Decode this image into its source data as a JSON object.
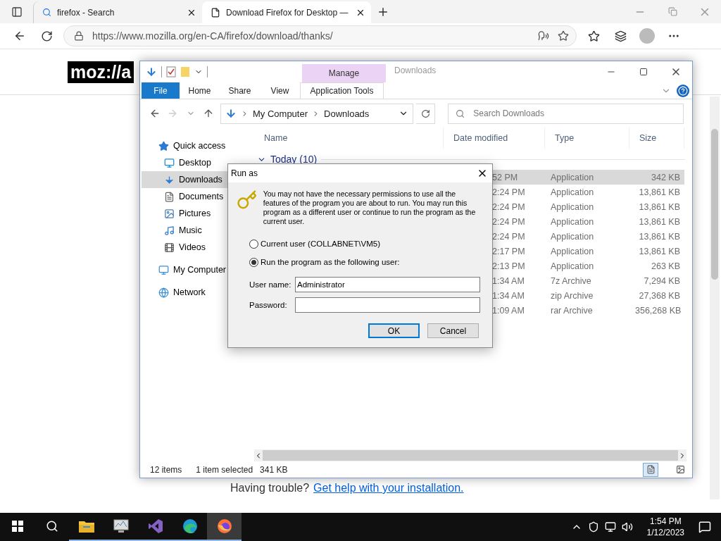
{
  "browser": {
    "tabs": [
      {
        "title": "firefox - Search",
        "kind": "search",
        "selected": false
      },
      {
        "title": "Download Firefox for Desktop —",
        "kind": "page",
        "selected": true
      }
    ],
    "url": "https://www.mozilla.org/en-CA/firefox/download/thanks/",
    "page": {
      "logo": "moz://a",
      "trouble": "Having trouble?",
      "help_link": "Get help with your installation."
    }
  },
  "explorer": {
    "title": "Downloads",
    "context_tab": "Manage",
    "ribbon_tabs": [
      {
        "label": "File",
        "kind": "file",
        "selected": false
      },
      {
        "label": "Home",
        "kind": "tab",
        "selected": false
      },
      {
        "label": "Share",
        "kind": "tab",
        "selected": false
      },
      {
        "label": "View",
        "kind": "tab",
        "selected": false
      },
      {
        "label": "Application Tools",
        "kind": "context",
        "selected": false
      }
    ],
    "breadcrumb": [
      "My Computer",
      "Downloads"
    ],
    "search": {
      "placeholder": "Search Downloads"
    },
    "nav": [
      {
        "label": "Quick access",
        "kind": "star",
        "selected": false,
        "children": [
          {
            "label": "Desktop",
            "kind": "desktop",
            "selected": false
          },
          {
            "label": "Downloads",
            "kind": "download",
            "selected": true
          },
          {
            "label": "Documents",
            "kind": "document",
            "selected": false
          },
          {
            "label": "Pictures",
            "kind": "picture",
            "selected": false
          },
          {
            "label": "Music",
            "kind": "music",
            "selected": false
          },
          {
            "label": "Videos",
            "kind": "video",
            "selected": false
          }
        ]
      },
      {
        "label": "My Computer",
        "kind": "computer",
        "selected": false
      },
      {
        "label": "Network",
        "kind": "network",
        "selected": false
      }
    ],
    "columns": [
      "Name",
      "Date modified",
      "Type",
      "Size"
    ],
    "group": "Today (10)",
    "rows": [
      {
        "date": "52 PM",
        "type": "Application",
        "size": "342 KB",
        "selected": true
      },
      {
        "date": "2:24 PM",
        "type": "Application",
        "size": "13,861 KB",
        "selected": false
      },
      {
        "date": "2:24 PM",
        "type": "Application",
        "size": "13,861 KB",
        "selected": false
      },
      {
        "date": "2:24 PM",
        "type": "Application",
        "size": "13,861 KB",
        "selected": false
      },
      {
        "date": "2:24 PM",
        "type": "Application",
        "size": "13,861 KB",
        "selected": false
      },
      {
        "date": "2:17 PM",
        "type": "Application",
        "size": "13,861 KB",
        "selected": false
      },
      {
        "date": "2:13 PM",
        "type": "Application",
        "size": "263 KB",
        "selected": false
      },
      {
        "date": "1:34 AM",
        "type": "7z Archive",
        "size": "7,294 KB",
        "selected": false
      },
      {
        "date": "1:34 AM",
        "type": "zip Archive",
        "size": "27,368 KB",
        "selected": false
      },
      {
        "date": "1:09 AM",
        "type": "rar Archive",
        "size": "356,268 KB",
        "selected": false
      }
    ],
    "status": {
      "count": "12 items",
      "selection": "1 item selected",
      "size": "341 KB"
    },
    "views": [
      {
        "kind": "details",
        "selected": true
      },
      {
        "kind": "tiles",
        "selected": false
      }
    ]
  },
  "dialog": {
    "title": "Run as",
    "message": "You may not have the necessary permissions to use all the features of the program you are about to run. You may run this program as a different user or continue to run the program as the current user.",
    "options": [
      {
        "label": "Current user (COLLABNET\\VM5)",
        "selected": false
      },
      {
        "label": "Run the program as the following user:",
        "selected": true
      }
    ],
    "fields": [
      {
        "label": "User name:",
        "value": "Administrator"
      },
      {
        "label": "Password:"
      }
    ],
    "buttons": [
      {
        "label": "OK",
        "kind": "default"
      },
      {
        "label": "Cancel",
        "kind": "normal"
      }
    ]
  },
  "taskbar": {
    "apps": [
      {
        "kind": "folder",
        "running": true,
        "selected": false
      },
      {
        "kind": "monitor",
        "running": true,
        "selected": false
      },
      {
        "kind": "ribbon",
        "running": true,
        "selected": false
      },
      {
        "kind": "wave",
        "running": true,
        "selected": false
      },
      {
        "kind": "fox",
        "running": true,
        "selected": true
      }
    ],
    "time": "1:54 PM",
    "date": "1/12/2023"
  }
}
